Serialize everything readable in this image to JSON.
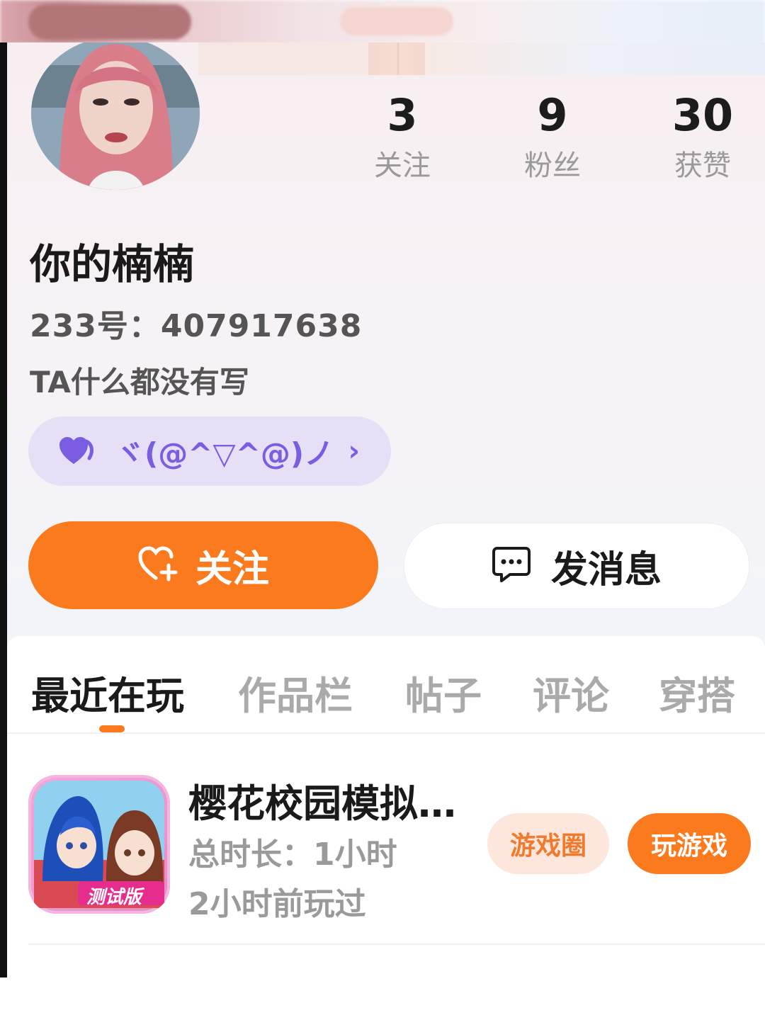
{
  "profile": {
    "name": "你的楠楠",
    "uid_text": "233号：407917638",
    "bio": "TA什么都没有写",
    "tag_text": "ヾ(@^▽^@)ノ"
  },
  "stats": [
    {
      "value": "3",
      "label": "关注"
    },
    {
      "value": "9",
      "label": "粉丝"
    },
    {
      "value": "30",
      "label": "获赞"
    }
  ],
  "actions": {
    "follow_label": "关注",
    "message_label": "发消息"
  },
  "tabs": [
    {
      "label": "最近在玩",
      "active": true
    },
    {
      "label": "作品栏",
      "active": false
    },
    {
      "label": "帖子",
      "active": false
    },
    {
      "label": "评论",
      "active": false
    },
    {
      "label": "穿搭",
      "active": false
    }
  ],
  "recent_game": {
    "title": "樱花校园模拟…",
    "total_time": "总时长：1小时",
    "last_played": "2小时前玩过",
    "icon_badge": "测试版",
    "circle_button": "游戏圈",
    "play_button": "玩游戏"
  },
  "colors": {
    "accent": "#fb7a1e",
    "tag_bg": "#e6e0f7",
    "tag_fg": "#7a5de0",
    "muted_text": "#9a9a9a"
  },
  "icons": {
    "tag": "heart-icon",
    "tag_arrow": "chevron-right-icon",
    "follow": "heart-plus-icon",
    "message": "chat-bubble-icon"
  }
}
